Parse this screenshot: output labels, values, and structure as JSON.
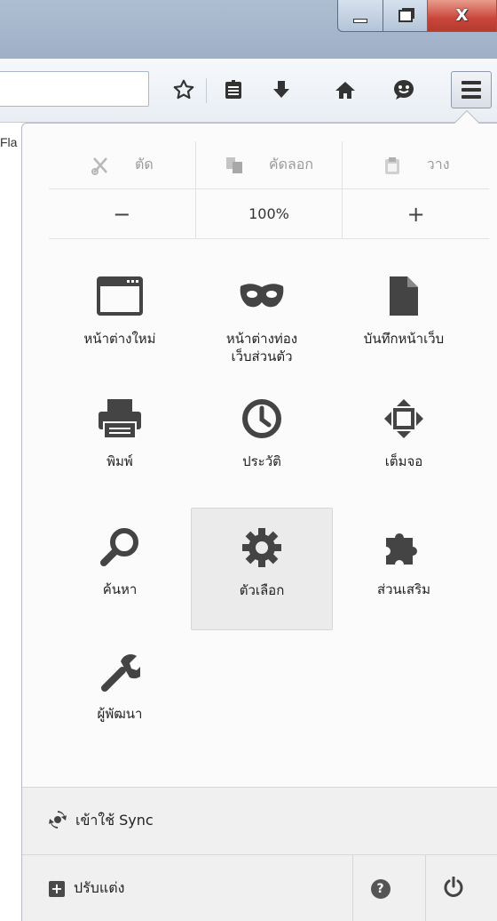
{
  "window": {
    "minimize_icon": "minimize-icon",
    "maximize_icon": "restore-icon",
    "close_icon": "close-icon",
    "close_label": "X"
  },
  "sidebar_peek": {
    "text": "Fla"
  },
  "toolbar": {
    "icons": [
      "star-icon",
      "reading-list-icon",
      "download-icon",
      "home-icon",
      "chat-icon",
      "menu-icon"
    ]
  },
  "menu": {
    "edit": {
      "cut": "ตัด",
      "copy": "คัดลอก",
      "paste": "วาง"
    },
    "zoom": {
      "minus": "−",
      "level": "100%",
      "plus": "+"
    },
    "items": [
      {
        "label": "หน้าต่างใหม่",
        "icon": "new-window-icon"
      },
      {
        "label": "หน้าต่างท่อง\nเว็บส่วนตัว",
        "icon": "private-mask-icon"
      },
      {
        "label": "บันทึกหน้าเว็บ",
        "icon": "save-page-icon"
      },
      {
        "label": "พิมพ์",
        "icon": "print-icon"
      },
      {
        "label": "ประวัติ",
        "icon": "history-clock-icon"
      },
      {
        "label": "เต็มจอ",
        "icon": "fullscreen-icon"
      },
      {
        "label": "ค้นหา",
        "icon": "search-icon"
      },
      {
        "label": "ตัวเลือก",
        "icon": "gear-icon"
      },
      {
        "label": "ส่วนเสริม",
        "icon": "addons-puzzle-icon"
      },
      {
        "label": "ผู้พัฒนา",
        "icon": "developer-wrench-icon"
      }
    ],
    "active_item": "ตัวเลือก",
    "sync_label": "เข้าใช้ Sync",
    "customize_label": "ปรับแต่ง",
    "help_symbol": "?"
  }
}
